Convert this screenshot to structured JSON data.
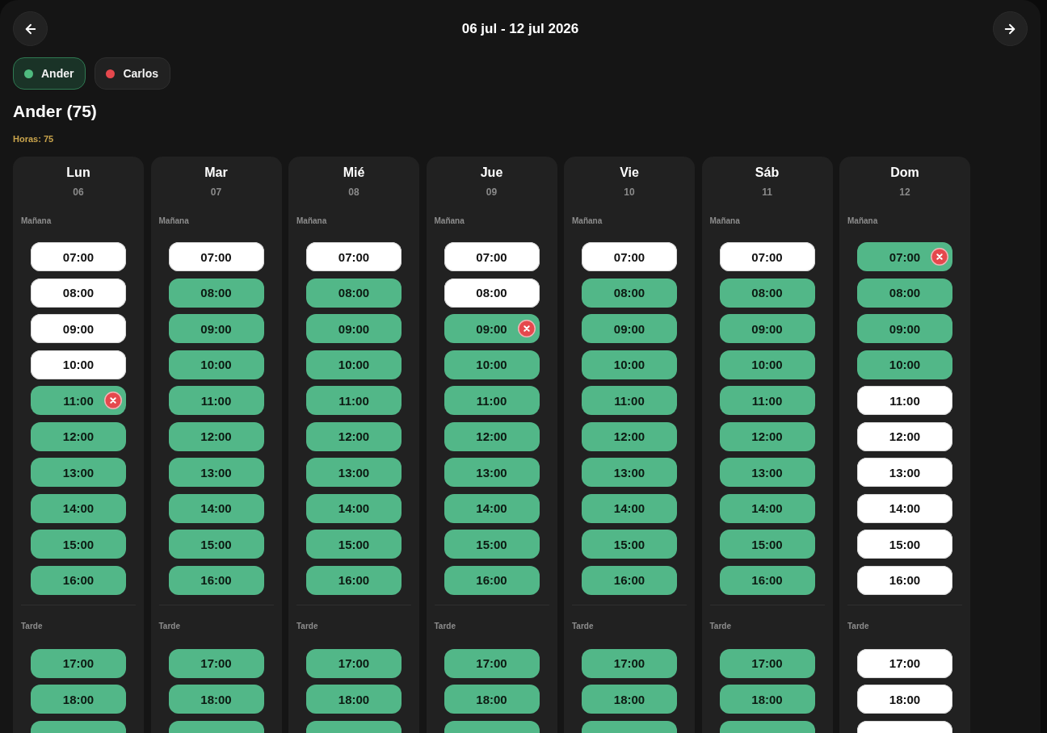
{
  "header": {
    "title": "06 jul - 12 jul 2026"
  },
  "people": [
    {
      "name": "Ander",
      "color": "#4fba7f",
      "selected": true
    },
    {
      "name": "Carlos",
      "color": "#e5484d",
      "selected": false
    }
  ],
  "summary": {
    "heading": "Ander (75)",
    "hours": "Horas: 75"
  },
  "days": [
    {
      "name": "Lun",
      "date": "06",
      "sections": [
        {
          "label": "Mañana",
          "slots": [
            {
              "time": "07:00",
              "assigned": false,
              "remove_badge": false
            },
            {
              "time": "08:00",
              "assigned": false,
              "remove_badge": false
            },
            {
              "time": "09:00",
              "assigned": false,
              "remove_badge": false
            },
            {
              "time": "10:00",
              "assigned": false,
              "remove_badge": false
            },
            {
              "time": "11:00",
              "assigned": true,
              "remove_badge": true
            },
            {
              "time": "12:00",
              "assigned": true,
              "remove_badge": false
            },
            {
              "time": "13:00",
              "assigned": true,
              "remove_badge": false
            },
            {
              "time": "14:00",
              "assigned": true,
              "remove_badge": false
            },
            {
              "time": "15:00",
              "assigned": true,
              "remove_badge": false
            },
            {
              "time": "16:00",
              "assigned": true,
              "remove_badge": false
            }
          ]
        },
        {
          "label": "Tarde",
          "slots": [
            {
              "time": "17:00",
              "assigned": true,
              "remove_badge": false
            },
            {
              "time": "18:00",
              "assigned": true,
              "remove_badge": false
            },
            {
              "assigned": true,
              "remove_badge": false
            }
          ]
        }
      ]
    },
    {
      "name": "Mar",
      "date": "07",
      "sections": [
        {
          "label": "Mañana",
          "slots": [
            {
              "time": "07:00",
              "assigned": false,
              "remove_badge": false
            },
            {
              "time": "08:00",
              "assigned": true,
              "remove_badge": false
            },
            {
              "time": "09:00",
              "assigned": true,
              "remove_badge": false
            },
            {
              "time": "10:00",
              "assigned": true,
              "remove_badge": false
            },
            {
              "time": "11:00",
              "assigned": true,
              "remove_badge": false
            },
            {
              "time": "12:00",
              "assigned": true,
              "remove_badge": false
            },
            {
              "time": "13:00",
              "assigned": true,
              "remove_badge": false
            },
            {
              "time": "14:00",
              "assigned": true,
              "remove_badge": false
            },
            {
              "time": "15:00",
              "assigned": true,
              "remove_badge": false
            },
            {
              "time": "16:00",
              "assigned": true,
              "remove_badge": false
            }
          ]
        },
        {
          "label": "Tarde",
          "slots": [
            {
              "time": "17:00",
              "assigned": true,
              "remove_badge": false
            },
            {
              "time": "18:00",
              "assigned": true,
              "remove_badge": false
            },
            {
              "assigned": true,
              "remove_badge": false
            }
          ]
        }
      ]
    },
    {
      "name": "Mié",
      "date": "08",
      "sections": [
        {
          "label": "Mañana",
          "slots": [
            {
              "time": "07:00",
              "assigned": false,
              "remove_badge": false
            },
            {
              "time": "08:00",
              "assigned": true,
              "remove_badge": false
            },
            {
              "time": "09:00",
              "assigned": true,
              "remove_badge": false
            },
            {
              "time": "10:00",
              "assigned": true,
              "remove_badge": false
            },
            {
              "time": "11:00",
              "assigned": true,
              "remove_badge": false
            },
            {
              "time": "12:00",
              "assigned": true,
              "remove_badge": false
            },
            {
              "time": "13:00",
              "assigned": true,
              "remove_badge": false
            },
            {
              "time": "14:00",
              "assigned": true,
              "remove_badge": false
            },
            {
              "time": "15:00",
              "assigned": true,
              "remove_badge": false
            },
            {
              "time": "16:00",
              "assigned": true,
              "remove_badge": false
            }
          ]
        },
        {
          "label": "Tarde",
          "slots": [
            {
              "time": "17:00",
              "assigned": true,
              "remove_badge": false
            },
            {
              "time": "18:00",
              "assigned": true,
              "remove_badge": false
            },
            {
              "assigned": true,
              "remove_badge": false
            }
          ]
        }
      ]
    },
    {
      "name": "Jue",
      "date": "09",
      "sections": [
        {
          "label": "Mañana",
          "slots": [
            {
              "time": "07:00",
              "assigned": false,
              "remove_badge": false
            },
            {
              "time": "08:00",
              "assigned": false,
              "remove_badge": false
            },
            {
              "time": "09:00",
              "assigned": true,
              "remove_badge": true
            },
            {
              "time": "10:00",
              "assigned": true,
              "remove_badge": false
            },
            {
              "time": "11:00",
              "assigned": true,
              "remove_badge": false
            },
            {
              "time": "12:00",
              "assigned": true,
              "remove_badge": false
            },
            {
              "time": "13:00",
              "assigned": true,
              "remove_badge": false
            },
            {
              "time": "14:00",
              "assigned": true,
              "remove_badge": false
            },
            {
              "time": "15:00",
              "assigned": true,
              "remove_badge": false
            },
            {
              "time": "16:00",
              "assigned": true,
              "remove_badge": false
            }
          ]
        },
        {
          "label": "Tarde",
          "slots": [
            {
              "time": "17:00",
              "assigned": true,
              "remove_badge": false
            },
            {
              "time": "18:00",
              "assigned": true,
              "remove_badge": false
            },
            {
              "assigned": true,
              "remove_badge": false
            }
          ]
        }
      ]
    },
    {
      "name": "Vie",
      "date": "10",
      "sections": [
        {
          "label": "Mañana",
          "slots": [
            {
              "time": "07:00",
              "assigned": false,
              "remove_badge": false
            },
            {
              "time": "08:00",
              "assigned": true,
              "remove_badge": false
            },
            {
              "time": "09:00",
              "assigned": true,
              "remove_badge": false
            },
            {
              "time": "10:00",
              "assigned": true,
              "remove_badge": false
            },
            {
              "time": "11:00",
              "assigned": true,
              "remove_badge": false
            },
            {
              "time": "12:00",
              "assigned": true,
              "remove_badge": false
            },
            {
              "time": "13:00",
              "assigned": true,
              "remove_badge": false
            },
            {
              "time": "14:00",
              "assigned": true,
              "remove_badge": false
            },
            {
              "time": "15:00",
              "assigned": true,
              "remove_badge": false
            },
            {
              "time": "16:00",
              "assigned": true,
              "remove_badge": false
            }
          ]
        },
        {
          "label": "Tarde",
          "slots": [
            {
              "time": "17:00",
              "assigned": true,
              "remove_badge": false
            },
            {
              "time": "18:00",
              "assigned": true,
              "remove_badge": false
            },
            {
              "assigned": true,
              "remove_badge": false
            }
          ]
        }
      ]
    },
    {
      "name": "Sáb",
      "date": "11",
      "sections": [
        {
          "label": "Mañana",
          "slots": [
            {
              "time": "07:00",
              "assigned": false,
              "remove_badge": false
            },
            {
              "time": "08:00",
              "assigned": true,
              "remove_badge": false
            },
            {
              "time": "09:00",
              "assigned": true,
              "remove_badge": false
            },
            {
              "time": "10:00",
              "assigned": true,
              "remove_badge": false
            },
            {
              "time": "11:00",
              "assigned": true,
              "remove_badge": false
            },
            {
              "time": "12:00",
              "assigned": true,
              "remove_badge": false
            },
            {
              "time": "13:00",
              "assigned": true,
              "remove_badge": false
            },
            {
              "time": "14:00",
              "assigned": true,
              "remove_badge": false
            },
            {
              "time": "15:00",
              "assigned": true,
              "remove_badge": false
            },
            {
              "time": "16:00",
              "assigned": true,
              "remove_badge": false
            }
          ]
        },
        {
          "label": "Tarde",
          "slots": [
            {
              "time": "17:00",
              "assigned": true,
              "remove_badge": false
            },
            {
              "time": "18:00",
              "assigned": true,
              "remove_badge": false
            },
            {
              "assigned": true,
              "remove_badge": false
            }
          ]
        }
      ]
    },
    {
      "name": "Dom",
      "date": "12",
      "sections": [
        {
          "label": "Mañana",
          "slots": [
            {
              "time": "07:00",
              "assigned": true,
              "remove_badge": true
            },
            {
              "time": "08:00",
              "assigned": true,
              "remove_badge": false
            },
            {
              "time": "09:00",
              "assigned": true,
              "remove_badge": false
            },
            {
              "time": "10:00",
              "assigned": true,
              "remove_badge": false
            },
            {
              "time": "11:00",
              "assigned": false,
              "remove_badge": false
            },
            {
              "time": "12:00",
              "assigned": false,
              "remove_badge": false
            },
            {
              "time": "13:00",
              "assigned": false,
              "remove_badge": false
            },
            {
              "time": "14:00",
              "assigned": false,
              "remove_badge": false
            },
            {
              "time": "15:00",
              "assigned": false,
              "remove_badge": false
            },
            {
              "time": "16:00",
              "assigned": false,
              "remove_badge": false
            }
          ]
        },
        {
          "label": "Tarde",
          "slots": [
            {
              "time": "17:00",
              "assigned": false,
              "remove_badge": false
            },
            {
              "time": "18:00",
              "assigned": false,
              "remove_badge": false
            },
            {
              "assigned": false,
              "remove_badge": false
            }
          ]
        }
      ]
    }
  ]
}
